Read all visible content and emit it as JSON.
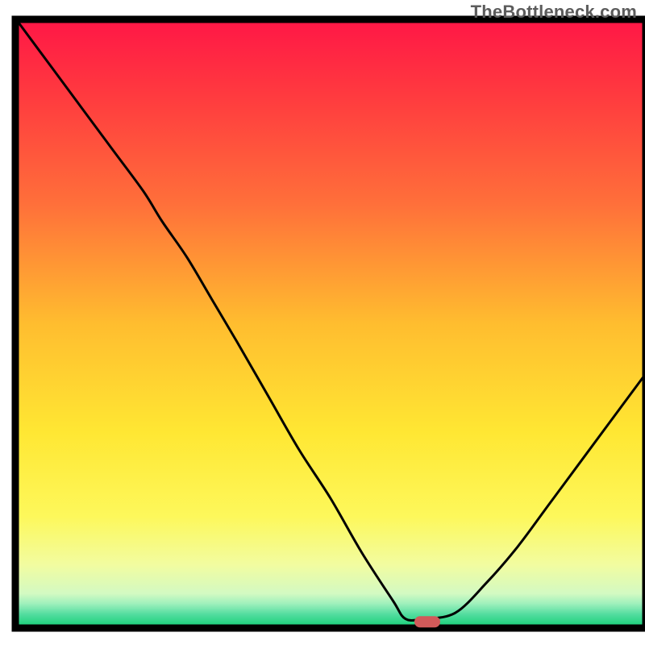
{
  "watermark": "TheBottleneck.com",
  "chart_data": {
    "type": "line",
    "title": "",
    "xlabel": "",
    "ylabel": "",
    "x": [
      0.0,
      0.05,
      0.1,
      0.15,
      0.2,
      0.23,
      0.27,
      0.31,
      0.35,
      0.4,
      0.45,
      0.5,
      0.55,
      0.6,
      0.62,
      0.65,
      0.7,
      0.75,
      0.8,
      0.85,
      0.9,
      0.95,
      1.0
    ],
    "values": [
      1.0,
      0.93,
      0.86,
      0.79,
      0.72,
      0.67,
      0.61,
      0.54,
      0.47,
      0.38,
      0.29,
      0.21,
      0.12,
      0.04,
      0.01,
      0.01,
      0.02,
      0.07,
      0.13,
      0.2,
      0.27,
      0.34,
      0.41
    ],
    "xlim": [
      0,
      1
    ],
    "ylim": [
      0,
      1
    ],
    "marker": {
      "x": 0.655,
      "y": 0.005
    },
    "gradient_stops": [
      {
        "offset": 0.0,
        "color": "#ff1846"
      },
      {
        "offset": 0.12,
        "color": "#ff3a3f"
      },
      {
        "offset": 0.3,
        "color": "#ff6f3a"
      },
      {
        "offset": 0.5,
        "color": "#ffbd2f"
      },
      {
        "offset": 0.68,
        "color": "#ffe733"
      },
      {
        "offset": 0.82,
        "color": "#fdf85b"
      },
      {
        "offset": 0.9,
        "color": "#f2fca0"
      },
      {
        "offset": 0.948,
        "color": "#d3fac2"
      },
      {
        "offset": 0.965,
        "color": "#9ef0bc"
      },
      {
        "offset": 0.982,
        "color": "#55dda0"
      },
      {
        "offset": 1.0,
        "color": "#1fd17d"
      }
    ],
    "marker_color": "#d15a5a",
    "curve_color": "#000000",
    "axis_color": "#000000"
  }
}
